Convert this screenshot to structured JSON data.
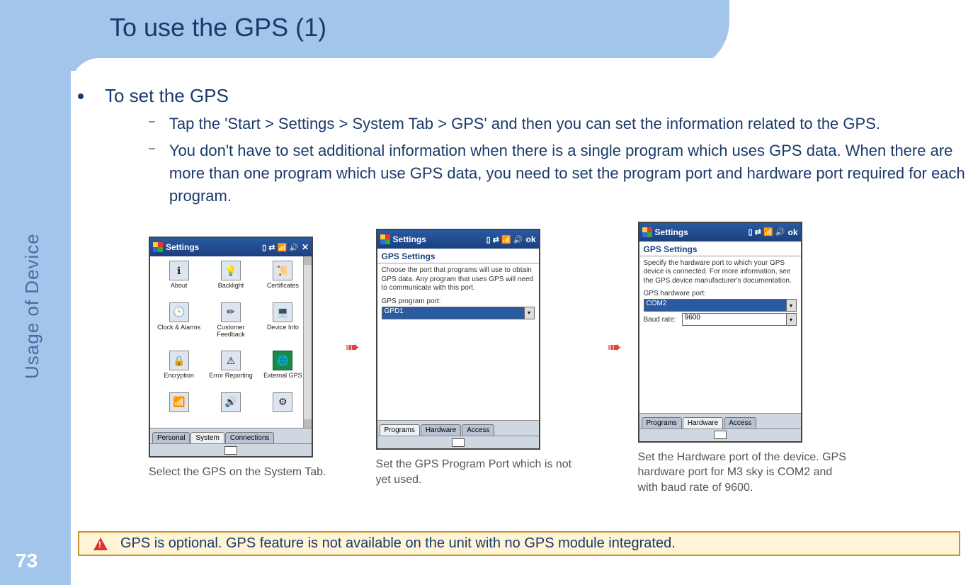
{
  "page": {
    "title": "To use the GPS (1)",
    "number": "73",
    "sidebar_label": "Usage of Device"
  },
  "main": {
    "heading": "To set the GPS",
    "point1": "Tap the 'Start > Settings > System Tab > GPS' and then you can set the information related to the GPS.",
    "point2": "You don't have to set additional information when there is a single program which uses GPS data. When there are more than one program which use GPS data, you need to set  the program port and hardware port required for each program."
  },
  "captions": {
    "c1": "Select the GPS on the System Tab.",
    "c2": "Set the GPS Program Port which is not yet used.",
    "c3": "Set the Hardware port of the device. GPS hardware port for M3 sky is COM2 and with baud rate of 9600."
  },
  "screens": {
    "common": {
      "title": "Settings",
      "status_close": "✕",
      "status_ok": "ok"
    },
    "s1": {
      "icons": [
        "About",
        "Backlight",
        "Certificates",
        "Clock & Alarms",
        "Customer Feedback",
        "Device Info",
        "Encryption",
        "Error Reporting",
        "External GPS"
      ],
      "tabs": [
        "Personal",
        "System",
        "Connections"
      ],
      "active_tab": 1
    },
    "s2": {
      "subtitle": "GPS Settings",
      "desc": "Choose the port that programs will use to obtain GPS data. Any program that uses GPS will need to communicate with this port.",
      "label": "GPS program port:",
      "value": "GPD1",
      "tabs": [
        "Programs",
        "Hardware",
        "Access"
      ],
      "active_tab": 0
    },
    "s3": {
      "subtitle": "GPS Settings",
      "desc": "Specify the hardware port to which your GPS device is connected. For more information, see the GPS device manufacturer's documentation.",
      "label1": "GPS hardware port:",
      "value1": "COM2",
      "label2": "Baud rate:",
      "value2": "9600",
      "tabs": [
        "Programs",
        "Hardware",
        "Access"
      ],
      "active_tab": 1
    }
  },
  "warning": "GPS is optional. GPS feature is not available on the unit with no GPS module integrated."
}
